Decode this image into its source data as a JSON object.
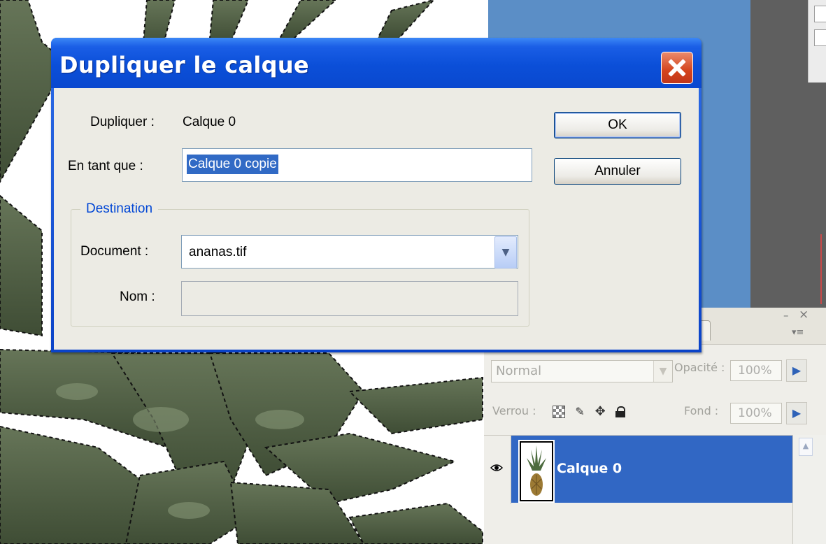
{
  "dialog": {
    "title": "Dupliquer le calque",
    "duplicate_label": "Dupliquer :",
    "duplicate_value": "Calque 0",
    "as_label": "En tant que :",
    "as_value": "Calque 0 copie",
    "destination_label": "Destination",
    "document_label": "Document :",
    "document_value": "ananas.tif",
    "name_label": "Nom :",
    "name_value": "",
    "ok_label": "OK",
    "cancel_label": "Annuler"
  },
  "layers_panel": {
    "blend_mode": "Normal",
    "opacity_label": "Opacité :",
    "opacity_value": "100%",
    "lock_label": "Verrou :",
    "fill_label": "Fond :",
    "fill_value": "100%",
    "layer_name": "Calque 0",
    "minimize_glyph": "–",
    "close_glyph": "×",
    "menu_glyph": "▾≡"
  },
  "colors": {
    "xp_title_blue": "#0b4fd8",
    "dialog_face": "#ecebe4",
    "selection_blue": "#316ac5",
    "layer_selected": "#3167c4",
    "close_red": "#d4441c",
    "legend_blue": "#0046d5"
  },
  "icons": {
    "close": "close-icon",
    "dropdown": "chevron-down-icon",
    "eye": "eye-icon",
    "lock_transparent": "checkerboard-lock-icon",
    "lock_image": "brush-lock-icon",
    "lock_position": "move-lock-icon",
    "lock_all": "padlock-icon"
  }
}
